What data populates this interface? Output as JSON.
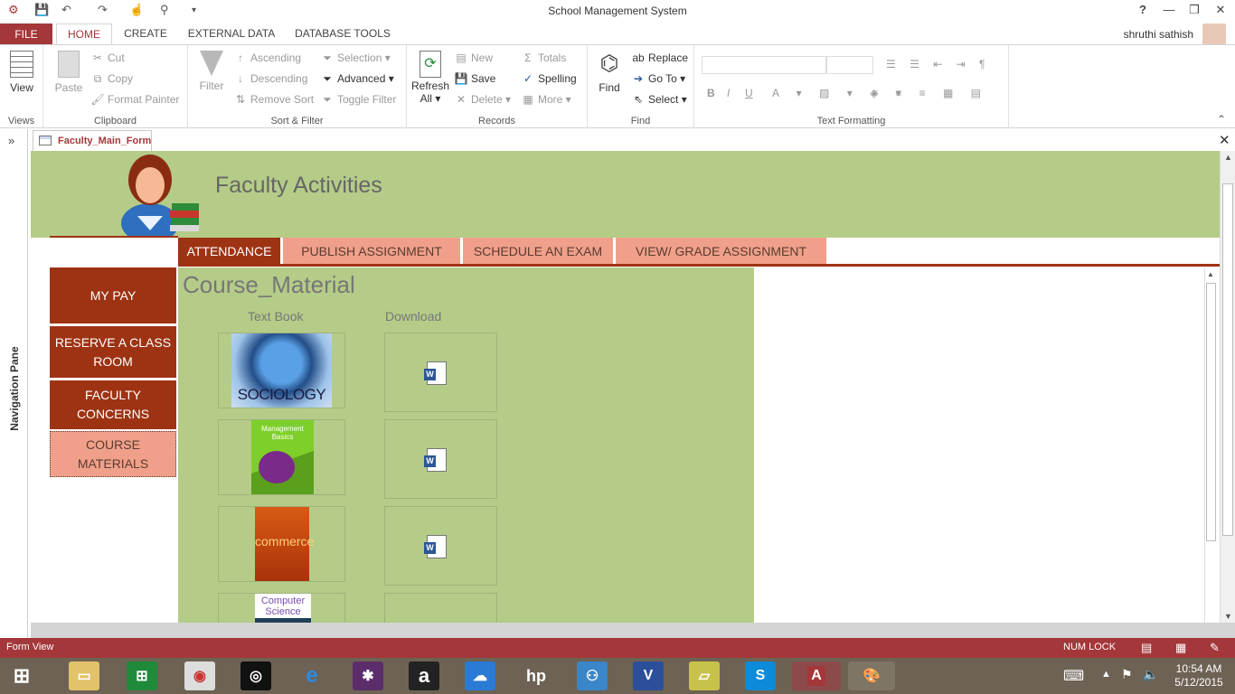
{
  "window": {
    "title": "School Management System",
    "user": "shruthi sathish"
  },
  "ribbon_tabs": [
    "FILE",
    "HOME",
    "CREATE",
    "EXTERNAL DATA",
    "DATABASE TOOLS"
  ],
  "ribbon": {
    "views": {
      "view": "View",
      "label": "Views"
    },
    "clipboard": {
      "paste": "Paste",
      "cut": "Cut",
      "copy": "Copy",
      "format_painter": "Format Painter",
      "label": "Clipboard"
    },
    "sort_filter": {
      "filter": "Filter",
      "ascending": "Ascending",
      "descending": "Descending",
      "remove_sort": "Remove Sort",
      "selection": "Selection",
      "advanced": "Advanced",
      "toggle_filter": "Toggle Filter",
      "label": "Sort & Filter"
    },
    "records": {
      "refresh": "Refresh",
      "refresh_all": "All",
      "new": "New",
      "save": "Save",
      "delete": "Delete",
      "totals": "Totals",
      "spelling": "Spelling",
      "more": "More",
      "label": "Records"
    },
    "find": {
      "find": "Find",
      "replace": "Replace",
      "go_to": "Go To",
      "select": "Select",
      "label": "Find"
    },
    "text_formatting": {
      "bold": "B",
      "italic": "I",
      "underline": "U",
      "label": "Text Formatting"
    }
  },
  "nav_pane": {
    "label": "Navigation Pane",
    "toggle": "»"
  },
  "document_tab": "Faculty_Main_Form",
  "form": {
    "header_title": "Faculty Activities",
    "tabs": [
      "ATTENDANCE",
      "PUBLISH ASSIGNMENT",
      "SCHEDULE AN EXAM",
      "VIEW/ GRADE ASSIGNMENT"
    ],
    "side_buttons": [
      {
        "line1": "MY PAY",
        "line2": ""
      },
      {
        "line1": "RESERVE A CLASS",
        "line2": "ROOM"
      },
      {
        "line1": "FACULTY",
        "line2": "CONCERNS"
      },
      {
        "line1": "COURSE",
        "line2": "MATERIALS"
      }
    ],
    "subform": {
      "title": "Course_Material",
      "col_textbook": "Text Book",
      "col_download": "Download",
      "books": [
        {
          "cover_text": "SOCIOLOGY"
        },
        {
          "cover_text1": "Management",
          "cover_text2": "Basics"
        },
        {
          "cover_text": "commerce"
        },
        {
          "cover_text1": "Computer",
          "cover_text2": "Science"
        }
      ]
    }
  },
  "status": {
    "mode": "Form View",
    "numlock": "NUM LOCK"
  },
  "taskbar": {
    "time": "10:54 AM",
    "date": "5/12/2015"
  },
  "colors": {
    "access_red": "#a4373a",
    "form_green": "#b5cc88",
    "tab_dark": "#9e3314",
    "tab_light": "#f0a08a"
  }
}
